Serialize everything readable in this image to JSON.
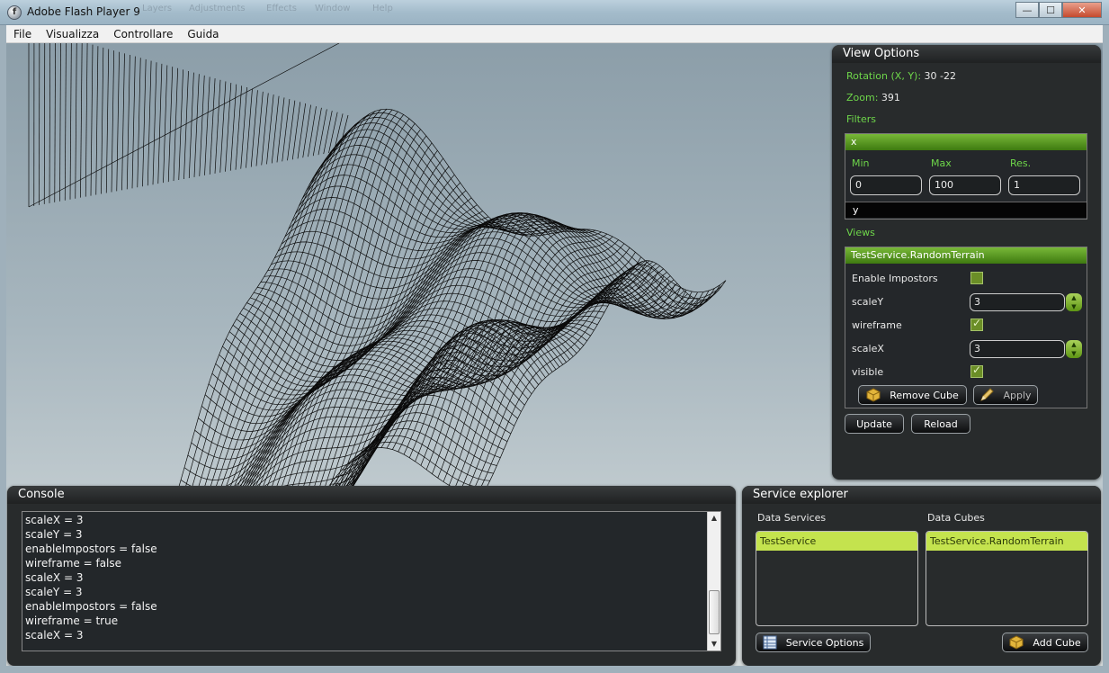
{
  "window": {
    "title": "Adobe Flash Player 9",
    "ghost_menu": [
      "Layers",
      "Adjustments",
      "Effects",
      "Window",
      "Help"
    ],
    "controls": {
      "minimize": "—",
      "maximize": "☐",
      "close": "✕"
    }
  },
  "menu": [
    "File",
    "Visualizza",
    "Controllare",
    "Guida"
  ],
  "view_options": {
    "title": "View Options",
    "rotation_label": "Rotation (X, Y):",
    "rotation_value": "30 -22",
    "zoom_label": "Zoom:",
    "zoom_value": "391",
    "filters_label": "Filters",
    "filter_x": {
      "name": "x",
      "min_label": "Min",
      "max_label": "Max",
      "res_label": "Res.",
      "min": "0",
      "max": "100",
      "res": "1"
    },
    "filter_y": {
      "name": "y"
    },
    "views_label": "Views",
    "view": {
      "name": "TestService.RandomTerrain",
      "enable_impostors_label": "Enable Impostors",
      "enable_impostors": false,
      "scaleY_label": "scaleY",
      "scaleY": "3",
      "wireframe_label": "wireframe",
      "wireframe": true,
      "scaleX_label": "scaleX",
      "scaleX": "3",
      "visible_label": "visible",
      "visible": true,
      "remove_label": "Remove Cube",
      "apply_label": "Apply"
    },
    "update_label": "Update",
    "reload_label": "Reload"
  },
  "console": {
    "title": "Console",
    "lines": [
      "scaleX = 3",
      "scaleY = 3",
      "enableImpostors = false",
      "wireframe = false",
      "scaleX = 3",
      "scaleY = 3",
      "enableImpostors = false",
      "wireframe = true",
      "scaleX = 3"
    ],
    "scroll_position": 0.85
  },
  "service_explorer": {
    "title": "Service explorer",
    "data_services_label": "Data Services",
    "data_cubes_label": "Data Cubes",
    "services": [
      "TestService"
    ],
    "cubes": [
      "TestService.RandomTerrain"
    ],
    "service_options_label": "Service Options",
    "add_cube_label": "Add Cube"
  },
  "colors": {
    "accent_green": "#6ed64a",
    "selection_lime": "#c4e34e",
    "panel_bg": "#282b2c"
  }
}
